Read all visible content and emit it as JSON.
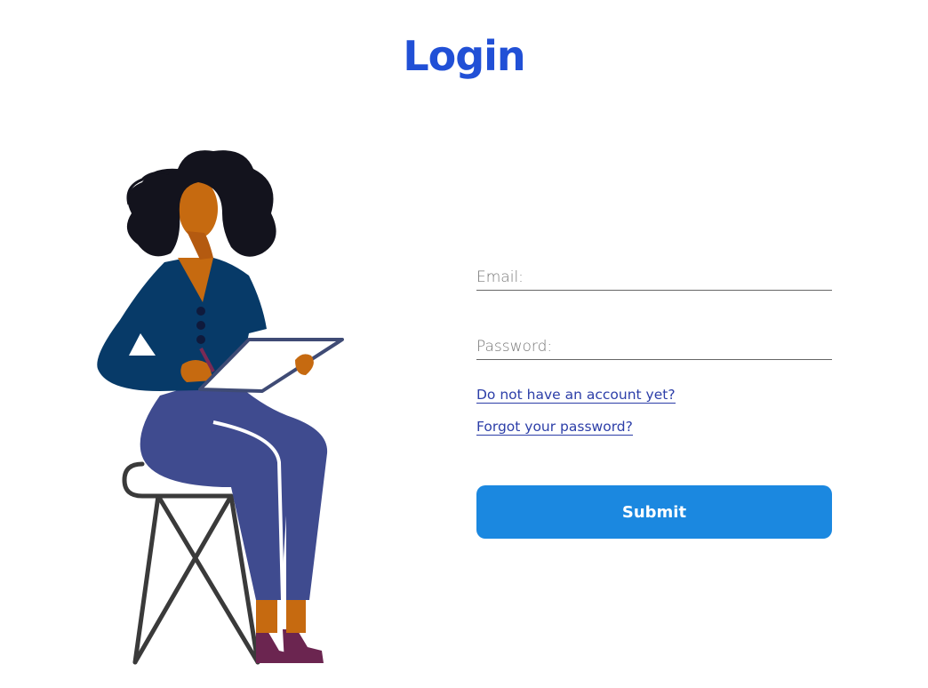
{
  "page": {
    "title": "Login"
  },
  "form": {
    "email": {
      "placeholder": "Email:",
      "value": ""
    },
    "password": {
      "placeholder": "Password:",
      "value": ""
    },
    "signup_link": "Do not have an account yet?",
    "forgot_link": "Forgot your password?",
    "submit_label": "Submit"
  },
  "colors": {
    "title": "#2150d6",
    "link": "#2c3ea8",
    "submit_bg": "#1b88e0",
    "submit_text": "#ffffff"
  },
  "illustration": {
    "icon": "woman-writing-on-tablet-illustration"
  }
}
